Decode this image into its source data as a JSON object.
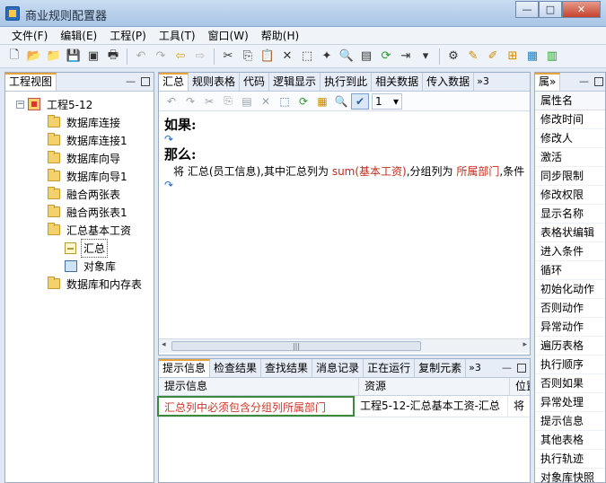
{
  "window": {
    "title": "商业规则配置器",
    "min_glyph": "—",
    "max_glyph": "□",
    "close_glyph": "✕"
  },
  "menu": [
    {
      "label": "文件(F)"
    },
    {
      "label": "编辑(E)"
    },
    {
      "label": "工程(P)"
    },
    {
      "label": "工具(T)"
    },
    {
      "label": "窗口(W)"
    },
    {
      "label": "帮助(H)"
    }
  ],
  "project_panel": {
    "tab": "工程视图",
    "root": "工程5-12",
    "items": [
      {
        "label": "数据库连接"
      },
      {
        "label": "数据库连接1"
      },
      {
        "label": "数据库向导"
      },
      {
        "label": "数据库向导1"
      },
      {
        "label": "融合两张表"
      },
      {
        "label": "融合两张表1"
      },
      {
        "label": "汇总基本工资"
      },
      {
        "label": "汇总"
      },
      {
        "label": "对象库"
      },
      {
        "label": "数据库和内存表"
      }
    ]
  },
  "editor": {
    "tabs": [
      {
        "label": "汇总"
      },
      {
        "label": "规则表格"
      },
      {
        "label": "代码"
      },
      {
        "label": "逻辑显示"
      },
      {
        "label": "执行到此"
      },
      {
        "label": "相关数据"
      },
      {
        "label": "传入数据"
      },
      {
        "label": "»3"
      }
    ],
    "combo_value": "1",
    "if_label": "如果:",
    "then_label": "那么:",
    "rule": {
      "p1": "将  汇总(员工信息),其中汇总列为 ",
      "p2": "sum(基本工资)",
      "p3": ",分组列为 ",
      "p4": "所属部门",
      "p5": ",条件"
    },
    "scroll_glyph": "|||"
  },
  "info_panel": {
    "tabs": [
      {
        "label": "提示信息"
      },
      {
        "label": "检查结果"
      },
      {
        "label": "查找结果"
      },
      {
        "label": "消息记录"
      },
      {
        "label": "正在运行"
      },
      {
        "label": "复制元素"
      },
      {
        "label": "»3"
      }
    ],
    "columns": [
      {
        "label": "提示信息"
      },
      {
        "label": "资源"
      },
      {
        "label": "位置"
      }
    ],
    "rows": [
      {
        "message": "汇总列中必须包含分组列所属部门",
        "resource": "工程5-12-汇总基本工资-汇总",
        "position": "将"
      }
    ]
  },
  "props_panel": {
    "tab": "属»",
    "header": "属性名",
    "items": [
      {
        "label": "修改时间"
      },
      {
        "label": "修改人"
      },
      {
        "label": "激活"
      },
      {
        "label": "同步限制"
      },
      {
        "label": "修改权限"
      },
      {
        "label": "显示名称"
      },
      {
        "label": "表格状编辑"
      },
      {
        "label": "进入条件"
      },
      {
        "label": "循环"
      },
      {
        "label": "初始化动作"
      },
      {
        "label": "否则动作"
      },
      {
        "label": "异常动作"
      },
      {
        "label": "遍历表格"
      },
      {
        "label": "执行顺序"
      },
      {
        "label": "否则如果"
      },
      {
        "label": "异常处理"
      },
      {
        "label": "提示信息"
      },
      {
        "label": "其他表格"
      },
      {
        "label": "执行轨迹"
      },
      {
        "label": "对象库快照"
      }
    ]
  }
}
